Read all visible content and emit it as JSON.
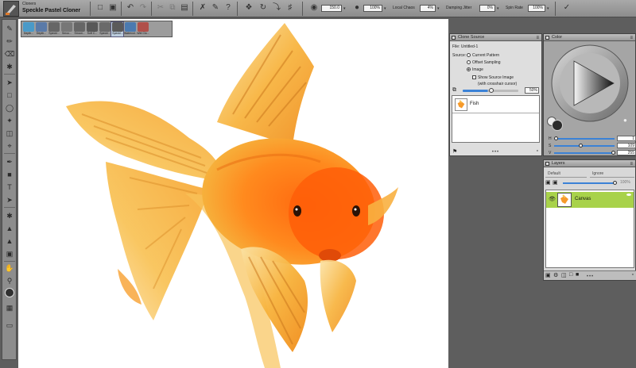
{
  "brush": {
    "category": "Cloners",
    "variant": "Speckle Pastel Cloner"
  },
  "toolbar": {
    "size_value": "150.0",
    "opacity_value": "100%",
    "local_chaos_label": "Local Chaos",
    "local_chaos_value": "4%",
    "damping_jitter_label": "Damping Jitter",
    "damping_jitter_value": "0%",
    "spin_rate_label": "Spin Rate",
    "spin_rate_value": "100%"
  },
  "variants": [
    {
      "label": "Depth..."
    },
    {
      "label": "Depth..."
    },
    {
      "label": "Speckl..."
    },
    {
      "label": "Smoo..."
    },
    {
      "label": "Smoot..."
    },
    {
      "label": "Soft C..."
    },
    {
      "label": "Speckl..."
    },
    {
      "label": "Speckl..."
    },
    {
      "label": "Watercol..."
    },
    {
      "label": "Wet Clo..."
    }
  ],
  "clone_source": {
    "title": "Clone Source",
    "file_label": "File: Untitled-1",
    "source_label": "Source:",
    "options": [
      "Current Pattern",
      "Offset Sampling",
      "Image"
    ],
    "selected": "Image",
    "show_source_label": "Show Source Image",
    "crosshair_label": "(with crosshair cursor)",
    "opacity": "50%",
    "items": [
      {
        "name": "Fish"
      }
    ]
  },
  "color": {
    "title": "Color",
    "main_color": "#2b2b2b",
    "channels": [
      {
        "label": "H",
        "value": "1",
        "fraction": 0.0
      },
      {
        "label": "S",
        "value": "109",
        "fraction": 0.43
      },
      {
        "label": "V",
        "value": "255",
        "fraction": 1.0
      }
    ]
  },
  "layers": {
    "title": "Layers",
    "blend_mode": "Default",
    "composite": "Ignore",
    "opacity": "100%",
    "items": [
      {
        "name": "Canvas",
        "selected_color": "#a8d24a"
      }
    ]
  }
}
